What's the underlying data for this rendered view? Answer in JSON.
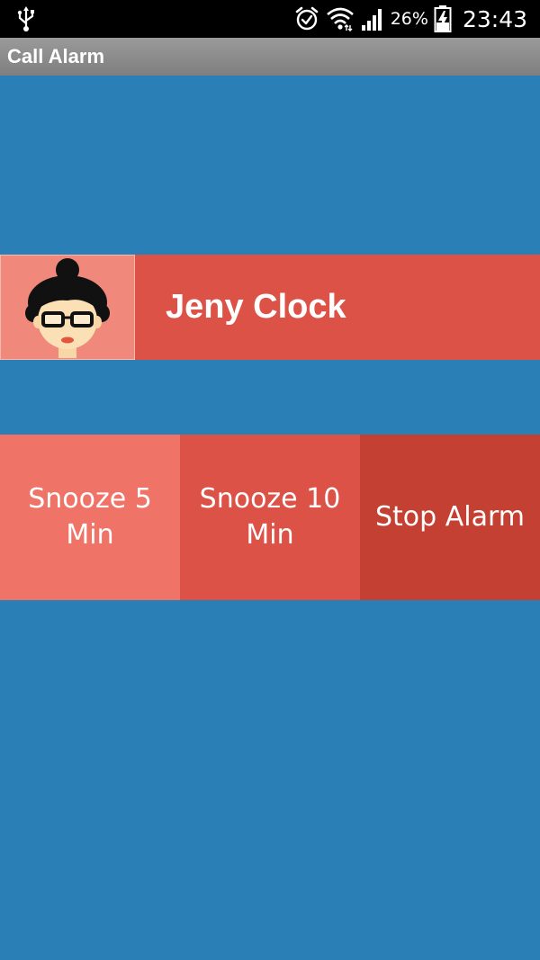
{
  "status_bar": {
    "left_icons": [
      "usb-icon"
    ],
    "right_icons": [
      "alarm-clock-icon",
      "wifi-icon",
      "signal-icon",
      "battery-charging-icon"
    ],
    "battery_percent": "26%",
    "time": "23:43"
  },
  "title_bar": {
    "title": "Call Alarm"
  },
  "caller": {
    "name": "Jeny Clock",
    "avatar_icon": "woman-avatar-icon"
  },
  "actions": [
    {
      "label": "Snooze 5 Min",
      "color": "#ef7367"
    },
    {
      "label": "Snooze 10 Min",
      "color": "#dc5246"
    },
    {
      "label": "Stop Alarm",
      "color": "#c44032"
    }
  ],
  "colors": {
    "background": "#2a7fb7",
    "caller_row": "#dc5246",
    "avatar_bg": "#f0897c",
    "title_bar": "#8a8a8a"
  }
}
